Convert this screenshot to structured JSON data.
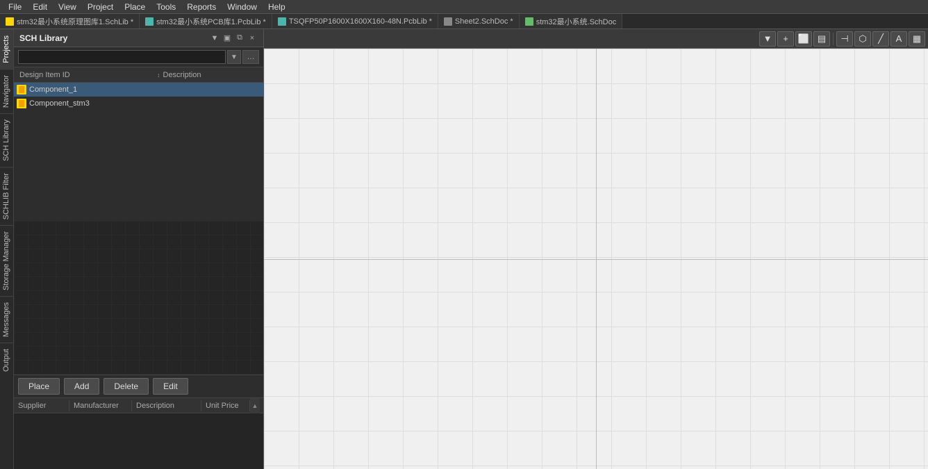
{
  "menubar": {
    "items": [
      "File",
      "Edit",
      "View",
      "Project",
      "Place",
      "Tools",
      "Reports",
      "Window",
      "Help"
    ]
  },
  "tabbar": {
    "tabs": [
      {
        "id": "sch-lib",
        "label": "stm32最小系统原理图库1.SchLib *",
        "type": "sch"
      },
      {
        "id": "pcb-lib",
        "label": "stm32最小系统PCB库1.PcbLib *",
        "type": "pcb"
      },
      {
        "id": "tsqfp",
        "label": "TSQFP50P1600X1600X160-48N.PcbLib *",
        "type": "pcb"
      },
      {
        "id": "sheet2",
        "label": "Sheet2.SchDoc *",
        "type": "sheet"
      },
      {
        "id": "stm32-sch",
        "label": "stm32最小系统.SchDoc",
        "type": "green"
      }
    ]
  },
  "sidebar": {
    "tabs": [
      "Projects",
      "Navigator",
      "SCH Library",
      "SCHLIB Filter",
      "Storage Manager",
      "Messages",
      "Output"
    ]
  },
  "panel": {
    "title": "SCH Library",
    "search_placeholder": "",
    "dropdown_icon": "▼",
    "more_icon": "…",
    "pin_icon": "▣",
    "close_icon": "×",
    "float_icon": "⧉",
    "columns": {
      "design_item_id": "Design Item ID",
      "description": "Description"
    },
    "sort_indicator": "↕",
    "components": [
      {
        "id": "Component_1",
        "description": ""
      },
      {
        "id": "Component_stm3",
        "description": ""
      }
    ],
    "buttons": {
      "place": "Place",
      "add": "Add",
      "delete": "Delete",
      "edit": "Edit"
    },
    "supplier_columns": [
      "Supplier",
      "Manufacturer",
      "Description",
      "Unit Price"
    ]
  },
  "toolbar": {
    "buttons": [
      {
        "id": "filter",
        "icon": "▼",
        "name": "filter-btn"
      },
      {
        "id": "add",
        "icon": "+",
        "name": "add-btn"
      },
      {
        "id": "rect-select",
        "icon": "⬜",
        "name": "rect-select-btn"
      },
      {
        "id": "print",
        "icon": "▤",
        "name": "print-btn"
      },
      {
        "id": "align-left",
        "icon": "⊣",
        "name": "align-left-btn"
      },
      {
        "id": "polygon",
        "icon": "⬡",
        "name": "polygon-btn"
      },
      {
        "id": "line",
        "icon": "╱",
        "name": "line-btn"
      },
      {
        "id": "text",
        "icon": "A",
        "name": "text-btn"
      },
      {
        "id": "table",
        "icon": "▦",
        "name": "table-btn"
      }
    ]
  }
}
